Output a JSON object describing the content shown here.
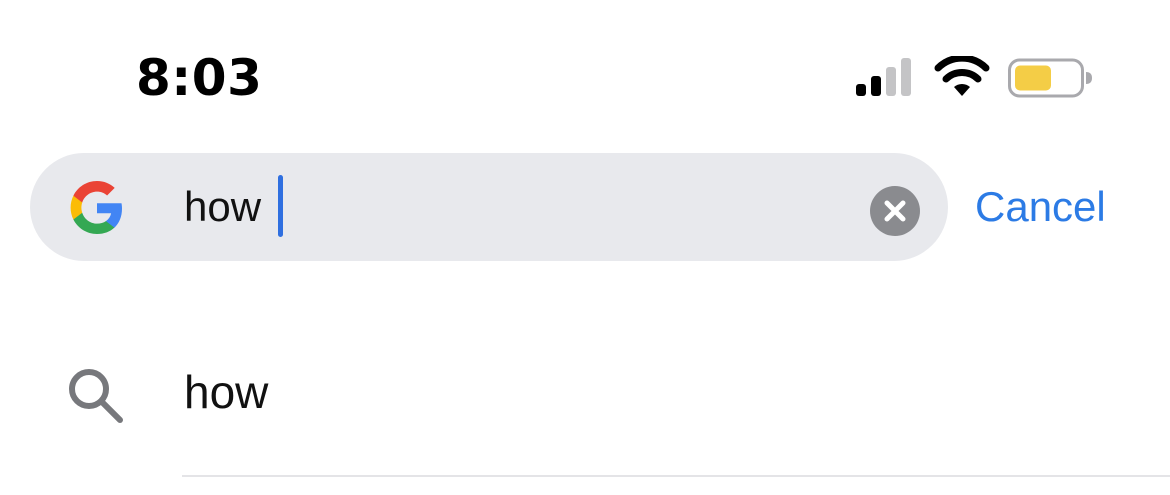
{
  "status_bar": {
    "time": "8:03",
    "signal_icon": "cellular-signal-icon",
    "wifi_icon": "wifi-icon",
    "battery_icon": "battery-icon",
    "battery_color": "#f4cd46"
  },
  "search": {
    "logo_icon": "google-logo-icon",
    "query": "how",
    "clear_icon": "clear-icon",
    "cancel_label": "Cancel",
    "background_color": "#e8e9ed",
    "accent_color": "#2c7be5"
  },
  "suggestions": [
    {
      "icon": "search-icon",
      "text": "how"
    }
  ]
}
